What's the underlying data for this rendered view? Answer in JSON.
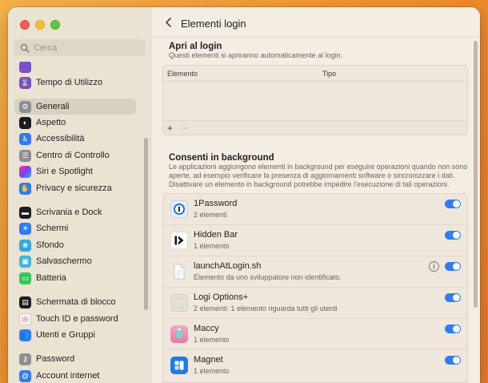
{
  "window": {
    "title": "Elementi login"
  },
  "sidebar": {
    "search_placeholder": "Cerca",
    "cut_item": "Tempo di Utilizzo",
    "items": [
      {
        "label": "Tempo di Utilizzo",
        "icon": "hourglass-icon",
        "color": "#7a4fd1"
      },
      {
        "label": "Generali",
        "icon": "gear-icon",
        "color": "#8e8e93",
        "selected": true
      },
      {
        "label": "Aspetto",
        "icon": "appearance-icon",
        "color": "#1c1c1e"
      },
      {
        "label": "Accessibilità",
        "icon": "accessibility-icon",
        "color": "#2f7bf6"
      },
      {
        "label": "Centro di Controllo",
        "icon": "control-center-icon",
        "color": "#8e8e93"
      },
      {
        "label": "Siri e Spotlight",
        "icon": "siri-icon",
        "color": "#c13bd0"
      },
      {
        "label": "Privacy e sicurezza",
        "icon": "hand-icon",
        "color": "#2f7bf6"
      },
      {
        "label": "Scrivania e Dock",
        "icon": "dock-icon",
        "color": "#1c1c1e"
      },
      {
        "label": "Schermi",
        "icon": "sun-icon",
        "color": "#2f7bf6"
      },
      {
        "label": "Sfondo",
        "icon": "wallpaper-icon",
        "color": "#32a8e0"
      },
      {
        "label": "Salvaschermo",
        "icon": "screensaver-icon",
        "color": "#3fb6d8"
      },
      {
        "label": "Batteria",
        "icon": "battery-icon",
        "color": "#34c759"
      },
      {
        "label": "Schermata di blocco",
        "icon": "lock-screen-icon",
        "color": "#1c1c1e"
      },
      {
        "label": "Touch ID e password",
        "icon": "fingerprint-icon",
        "color": "#f2f2f2"
      },
      {
        "label": "Utenti e Gruppi",
        "icon": "users-icon",
        "color": "#2f7bf6"
      },
      {
        "label": "Password",
        "icon": "key-icon",
        "color": "#8e8e93"
      },
      {
        "label": "Account internet",
        "icon": "at-icon",
        "color": "#2f7bf6"
      }
    ]
  },
  "open_at_login": {
    "title": "Apri al login",
    "description": "Questi elementi si apriranno automaticamente al login.",
    "col_item": "Elemento",
    "col_type": "Tipo",
    "add": "+",
    "remove": "−"
  },
  "background": {
    "title": "Consenti in background",
    "description_1": "Le applicazioni aggiungono elementi in background per eseguire operazioni quando non sono",
    "description_2": "aperte, ad esempio verificare la presenza di aggiornamenti software o sincronizzare i dati.",
    "description_3": "Disattivare un elemento in background potrebbe impedire l'esecuzione di tali operazioni.",
    "items": [
      {
        "name": "1Password",
        "sub": "2 elementi",
        "icon": "1password-icon",
        "enabled": true
      },
      {
        "name": "Hidden Bar",
        "sub": "1 elemento",
        "icon": "hidden-bar-icon",
        "enabled": true
      },
      {
        "name": "launchAtLogin.sh",
        "sub": "Elemento da uno sviluppatore non identificato.",
        "icon": "document-icon",
        "enabled": true,
        "info": true
      },
      {
        "name": "Logi Options+",
        "sub": "2 elementi: 1 elemento riguarda tutti gli utenti",
        "icon": "generic-app-icon",
        "enabled": true
      },
      {
        "name": "Maccy",
        "sub": "1 elemento",
        "icon": "maccy-icon",
        "enabled": true
      },
      {
        "name": "Magnet",
        "sub": "1 elemento",
        "icon": "magnet-icon",
        "enabled": true
      }
    ]
  }
}
